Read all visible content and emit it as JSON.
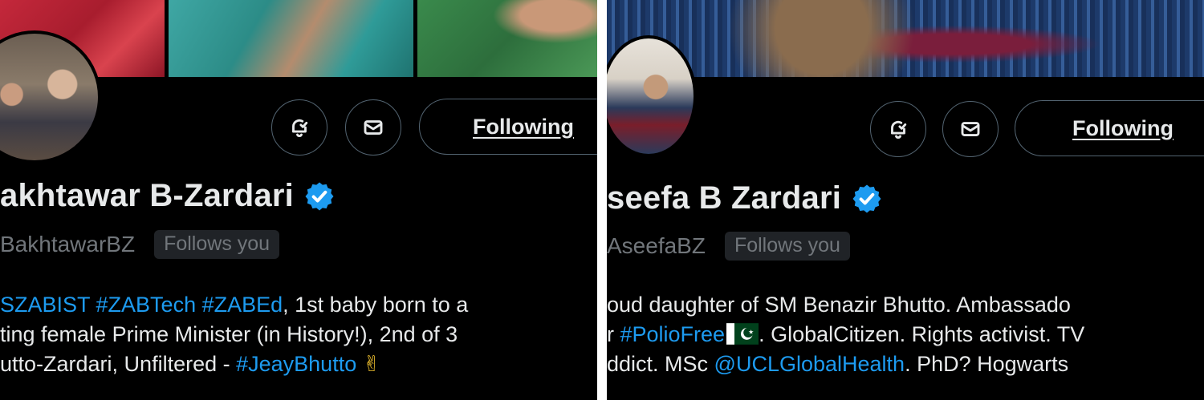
{
  "left": {
    "display_name": "akhtawar B-Zardari",
    "handle": "BakhtawarBZ",
    "follows_badge": "Follows you",
    "follow_button": "Following",
    "bio": {
      "line1_tags": "SZABIST #ZABTech #ZABEd",
      "line1_text": ", 1st baby born to a",
      "line2_text": "ting female Prime Minister (in History!), 2nd of 3",
      "line3_text": "utto-Zardari, Unfiltered - ",
      "line3_tag": "#JeayBhutto",
      "line3_emoji": "✌"
    }
  },
  "right": {
    "display_name": "seefa B Zardari",
    "handle": "AseefaBZ",
    "follows_badge": "Follows you",
    "follow_button": "Following",
    "bio": {
      "line1_text": "oud daughter of SM Benazir Bhutto. Ambassado",
      "line2_prefix": "r ",
      "line2_tag": "#PolioFree",
      "line2_text": ". GlobalCitizen. Rights activist. TV",
      "line3_prefix": "ddict. MSc ",
      "line3_mention": "@UCLGlobalHealth",
      "line3_text": ". PhD? Hogwarts"
    }
  },
  "colors": {
    "background": "#000000",
    "text": "#e7e9ea",
    "muted": "#71767b",
    "link": "#1d9bf0",
    "border": "#536471",
    "badge_bg": "#202327",
    "divider": "#ffffff"
  },
  "icons": [
    "notification-bell-icon",
    "message-envelope-icon",
    "verified-badge-icon",
    "pakistan-flag-icon"
  ]
}
